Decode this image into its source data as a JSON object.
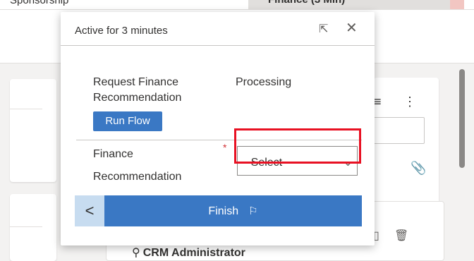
{
  "background": {
    "breadcrumb": "Sponsorship",
    "active_stage": "Finance (3 Min)",
    "timeline_author": "CRM Administrator",
    "icons": {
      "list": "list-icon",
      "more": "more-vertical-icon",
      "attach": "paperclip-icon",
      "edit": "edit-icon",
      "delete": "trash-icon",
      "person": "person-icon"
    }
  },
  "flyout": {
    "title": "Active for 3 minutes",
    "step": {
      "label": "Request Finance Recommendation",
      "status": "Processing",
      "action_label": "Run Flow"
    },
    "field": {
      "label": "Finance Recommendation",
      "required_marker": "*",
      "value": "--Select--"
    },
    "footer": {
      "back_label": "<",
      "finish_label": "Finish"
    },
    "icons": {
      "expand": "expand-icon",
      "close": "close-icon",
      "chevron": "chevron-down-icon",
      "flag": "flag-icon"
    }
  },
  "colors": {
    "accent": "#3a78c4",
    "back_button": "#c7dcf0",
    "highlight": "#e81123",
    "required": "#d13438"
  }
}
